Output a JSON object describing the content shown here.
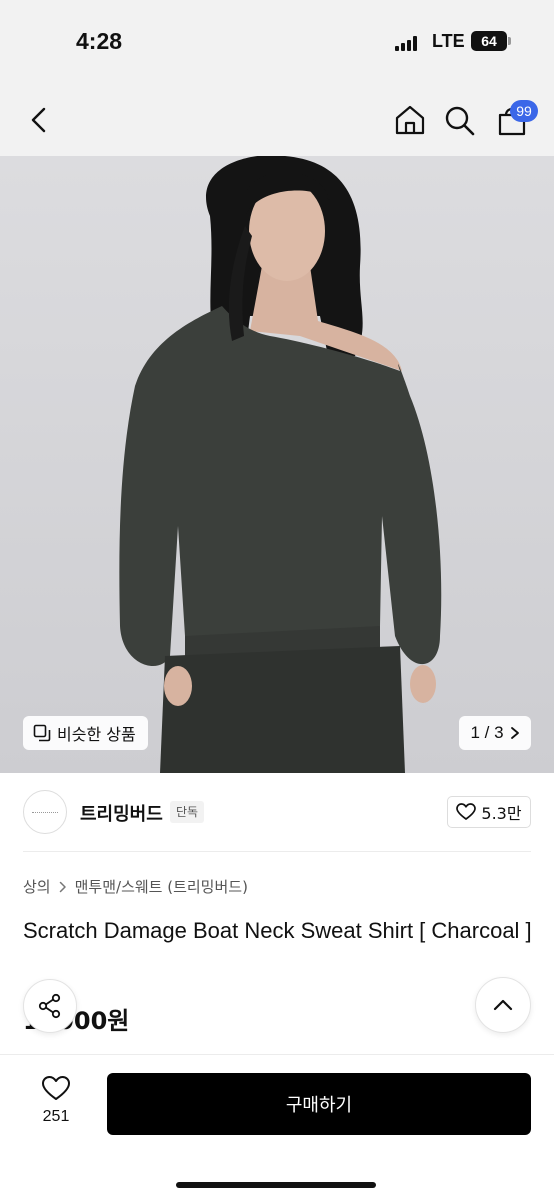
{
  "status_bar": {
    "time": "4:28",
    "network": "LTE",
    "battery": "64"
  },
  "nav": {
    "back_icon": "chevron-left-icon",
    "home_icon": "home-icon",
    "search_icon": "search-icon",
    "cart_icon": "cart-icon",
    "cart_badge": "99"
  },
  "gallery": {
    "similar_label": "비슷한 상품",
    "similar_icon": "copy-icon",
    "pager_label": "1 / 3",
    "pager_icon": "chevron-right-icon"
  },
  "store": {
    "name": "트리밍버드",
    "tag": "단독",
    "likes": "5.3만",
    "like_icon": "heart-icon"
  },
  "product": {
    "breadcrumb": [
      "상의",
      "맨투맨/스웨트 (트리밍버드)"
    ],
    "title": "Scratch Damage Boat Neck Sweat Shirt [ Charcoal ]",
    "price": "1 ,000원"
  },
  "floating": {
    "share_icon": "share-icon",
    "top_icon": "chevron-up-icon"
  },
  "bottom_bar": {
    "like_count": "251",
    "buy_label": "구매하기"
  },
  "colors": {
    "accent": "#3b67e8",
    "buy_button": "#000000",
    "sweatshirt": "#3b3f3b"
  }
}
